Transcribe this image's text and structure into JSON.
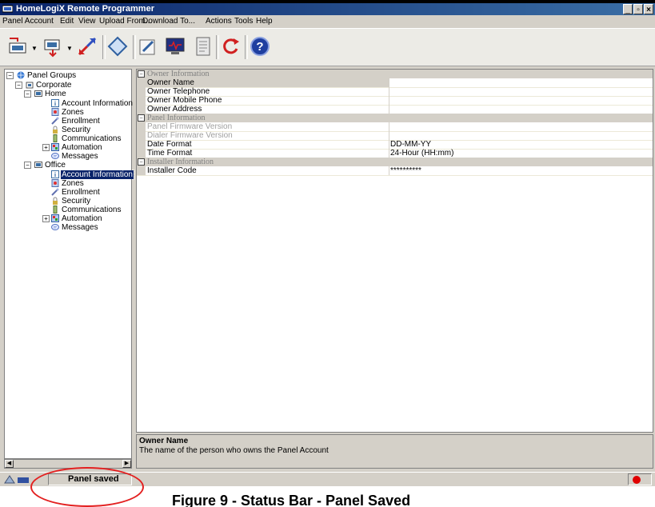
{
  "window": {
    "title": "HomeLogiX Remote Programmer",
    "controls": [
      "_",
      "▫",
      "×"
    ]
  },
  "menu": [
    "Panel Account",
    "Edit",
    "View",
    "Upload From...",
    "Download To...",
    "Actions",
    "Tools",
    "Help"
  ],
  "tree": {
    "root": "Panel Groups",
    "group": "Corporate",
    "home": {
      "label": "Home",
      "items": [
        "Account Information",
        "Zones",
        "Enrollment",
        "Security",
        "Communications",
        "Automation",
        "Messages"
      ]
    },
    "office": {
      "label": "Office",
      "items": [
        "Account Information",
        "Zones",
        "Enrollment",
        "Security",
        "Communications",
        "Automation",
        "Messages"
      ],
      "selected": "Account Information"
    }
  },
  "grid": {
    "owner_category": "Owner Information",
    "owner_name": "Owner Name",
    "owner_telephone": "Owner Telephone",
    "owner_mobile": "Owner Mobile Phone",
    "owner_address": "Owner Address",
    "panel_category": "Panel Information",
    "panel_fw": "Panel Firmware Version",
    "dialer_fw": "Dialer Firmware Version",
    "date_format": "Date Format",
    "date_format_value": "DD-MM-YY",
    "time_format": "Time Format",
    "time_format_value": "24-Hour (HH:mm)",
    "installer_category": "Installer Information",
    "installer_code": "Installer Code",
    "installer_code_value": "**********"
  },
  "description": {
    "title": "Owner Name",
    "text": "The name of the person who owns the Panel Account"
  },
  "status": {
    "text": "Panel saved",
    "indicator_color": "#e00000"
  },
  "caption": "Figure 9 - Status Bar - Panel Saved",
  "colors": {
    "selection": "#0a246a",
    "annotation": "#e32020"
  }
}
